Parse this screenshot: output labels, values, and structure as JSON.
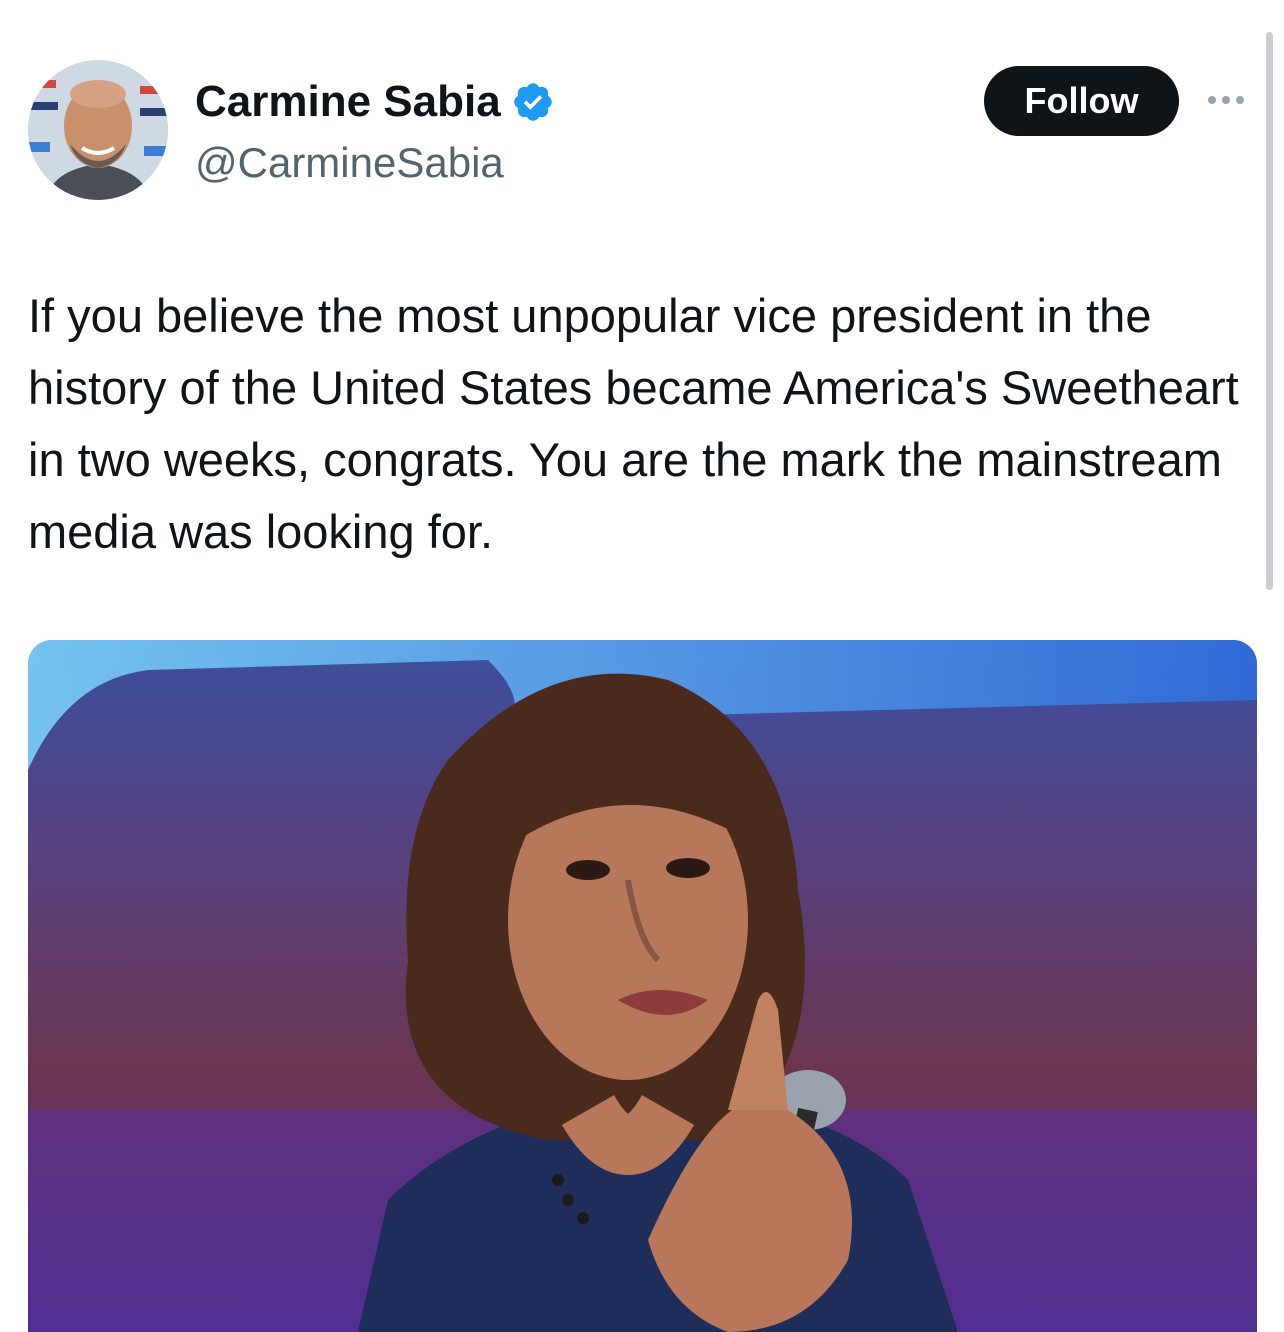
{
  "author": {
    "name": "Carmine Sabia",
    "handle": "@CarmineSabia",
    "verified": true,
    "avatar_icon": "avatar-photo"
  },
  "actions": {
    "follow_label": "Follow",
    "more_icon": "more-horizontal-icon"
  },
  "tweet": {
    "text": "If you believe the most unpopular vice president in the history of the United States became America's Sweetheart in two weeks, congrats. You are the mark the mainstream media was looking for."
  },
  "media": {
    "icon": "photo-image"
  },
  "colors": {
    "follow_bg": "#0f1419",
    "verified_blue": "#1d9bf0",
    "handle_gray": "#536471"
  }
}
